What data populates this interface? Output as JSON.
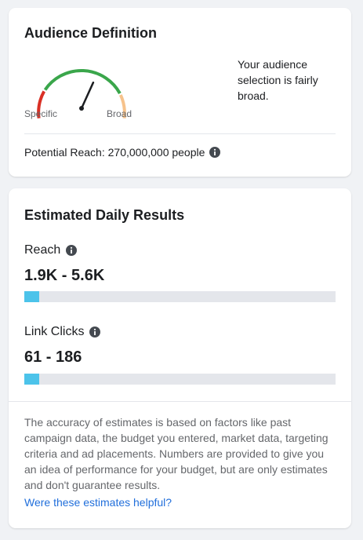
{
  "audience": {
    "title": "Audience Definition",
    "gauge_label_left": "Specific",
    "gauge_label_right": "Broad",
    "gauge_level": 0.62,
    "description": "Your audience selection is fairly broad.",
    "potential_reach": "Potential Reach: 270,000,000 people"
  },
  "results": {
    "title": "Estimated Daily Results",
    "reach": {
      "label": "Reach",
      "value": "1.9K - 5.6K",
      "bar_fraction": 0.047
    },
    "link_clicks": {
      "label": "Link Clicks",
      "value": "61 - 186",
      "bar_fraction": 0.047
    },
    "disclaimer": "The accuracy of estimates is based on factors like past campaign data, the budget you entered, market data, targeting criteria and ad placements. Numbers are provided to give you an idea of performance for your budget, but are only estimates and don't guarantee results.",
    "feedback_link": "Were these estimates helpful?"
  },
  "colors": {
    "gauge_red": "#d93025",
    "gauge_green": "#3aa64b",
    "gauge_orange": "#f6c28b",
    "needle": "#1c1e21",
    "bar_fill": "#4cc3ea",
    "link": "#216fdb"
  },
  "icons": {
    "info": "info-icon"
  }
}
